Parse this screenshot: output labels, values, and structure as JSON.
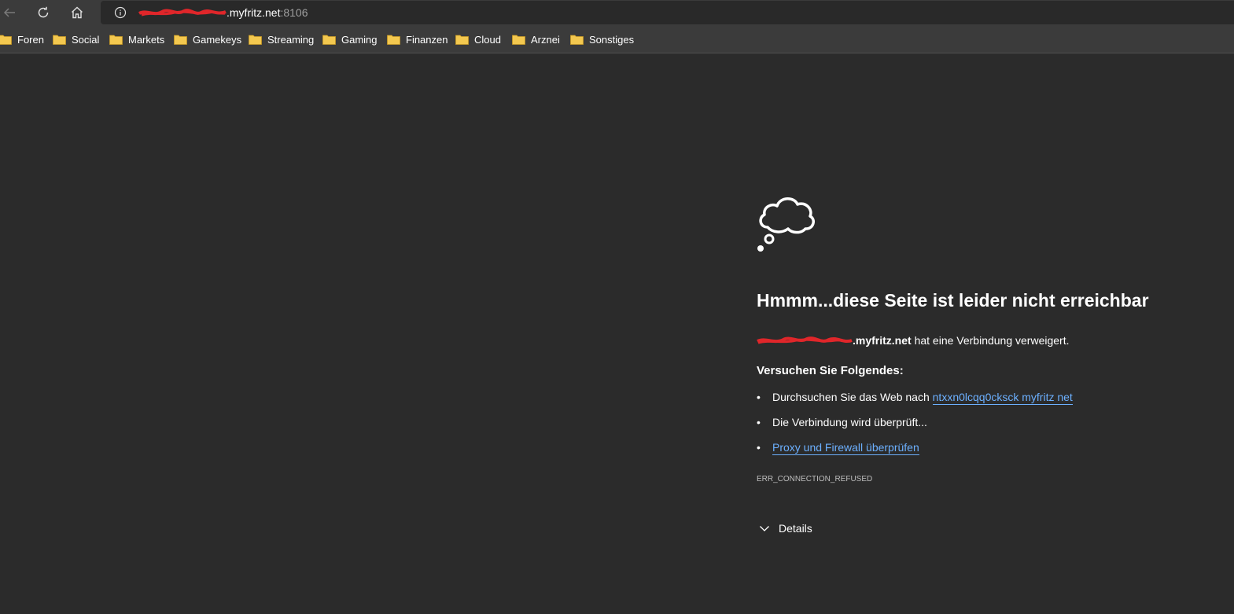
{
  "toolbar": {
    "url_host_visible": ".myfritz.net",
    "url_port": ":8106"
  },
  "bookmarks": [
    {
      "label": "Foren"
    },
    {
      "label": "Social"
    },
    {
      "label": "Markets"
    },
    {
      "label": "Gamekeys"
    },
    {
      "label": "Streaming"
    },
    {
      "label": "Gaming"
    },
    {
      "label": "Finanzen"
    },
    {
      "label": "Cloud"
    },
    {
      "label": "Arznei"
    },
    {
      "label": "Sonstiges"
    }
  ],
  "error": {
    "title": "Hmmm...diese Seite ist leider nicht erreichbar",
    "host_visible": ".myfritz.net",
    "refused_text": " hat eine Verbindung verweigert.",
    "try_heading": "Versuchen Sie Folgendes:",
    "suggestions": [
      {
        "prefix": "Durchsuchen Sie das Web nach ",
        "link": "ntxxn0lcqq0cksck myfritz net"
      },
      {
        "prefix": "Die Verbindung wird überprüft...",
        "link": ""
      },
      {
        "prefix": "",
        "link": "Proxy und Firewall überprüfen"
      }
    ],
    "bullet": "•",
    "code": "ERR_CONNECTION_REFUSED",
    "details_label": "Details"
  },
  "colors": {
    "page_bg": "#2b2b2b",
    "toolbar_bg": "#3b3b3b",
    "link": "#6cb0ff",
    "folder": "#f3c84f",
    "redaction": "#e0262a"
  }
}
